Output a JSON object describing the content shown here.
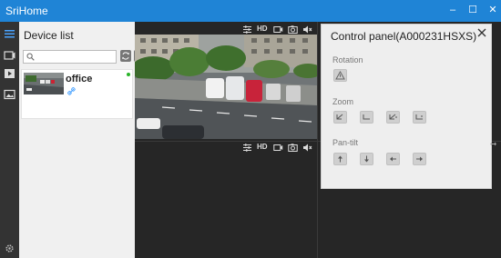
{
  "window": {
    "title": "SriHome",
    "min_icon": "minimize-icon",
    "max_icon": "maximize-icon",
    "close_icon": "close-icon"
  },
  "rail": {
    "icons": [
      "menu-icon",
      "video-icon",
      "playback-icon",
      "gallery-icon",
      "settings-icon"
    ]
  },
  "device_list": {
    "title": "Device list",
    "search": {
      "placeholder": "",
      "value": ""
    },
    "devices": [
      {
        "name": "office",
        "status": "online",
        "status_color": "#2ab42a"
      }
    ]
  },
  "video": {
    "toolbar": {
      "quality_label": "HD"
    },
    "icons": [
      "adjust-icon",
      "record-icon",
      "snapshot-icon",
      "volume-icon"
    ]
  },
  "control_panel": {
    "title": "Control panel(A000231HSXS)",
    "sections": {
      "rotation": "Rotation",
      "zoom": "Zoom",
      "pan_tilt": "Pan-tilt"
    }
  },
  "colors": {
    "accent": "#1f84d6",
    "rail": "#333333",
    "panel": "#f0f0f0",
    "video_bg": "#262626"
  }
}
